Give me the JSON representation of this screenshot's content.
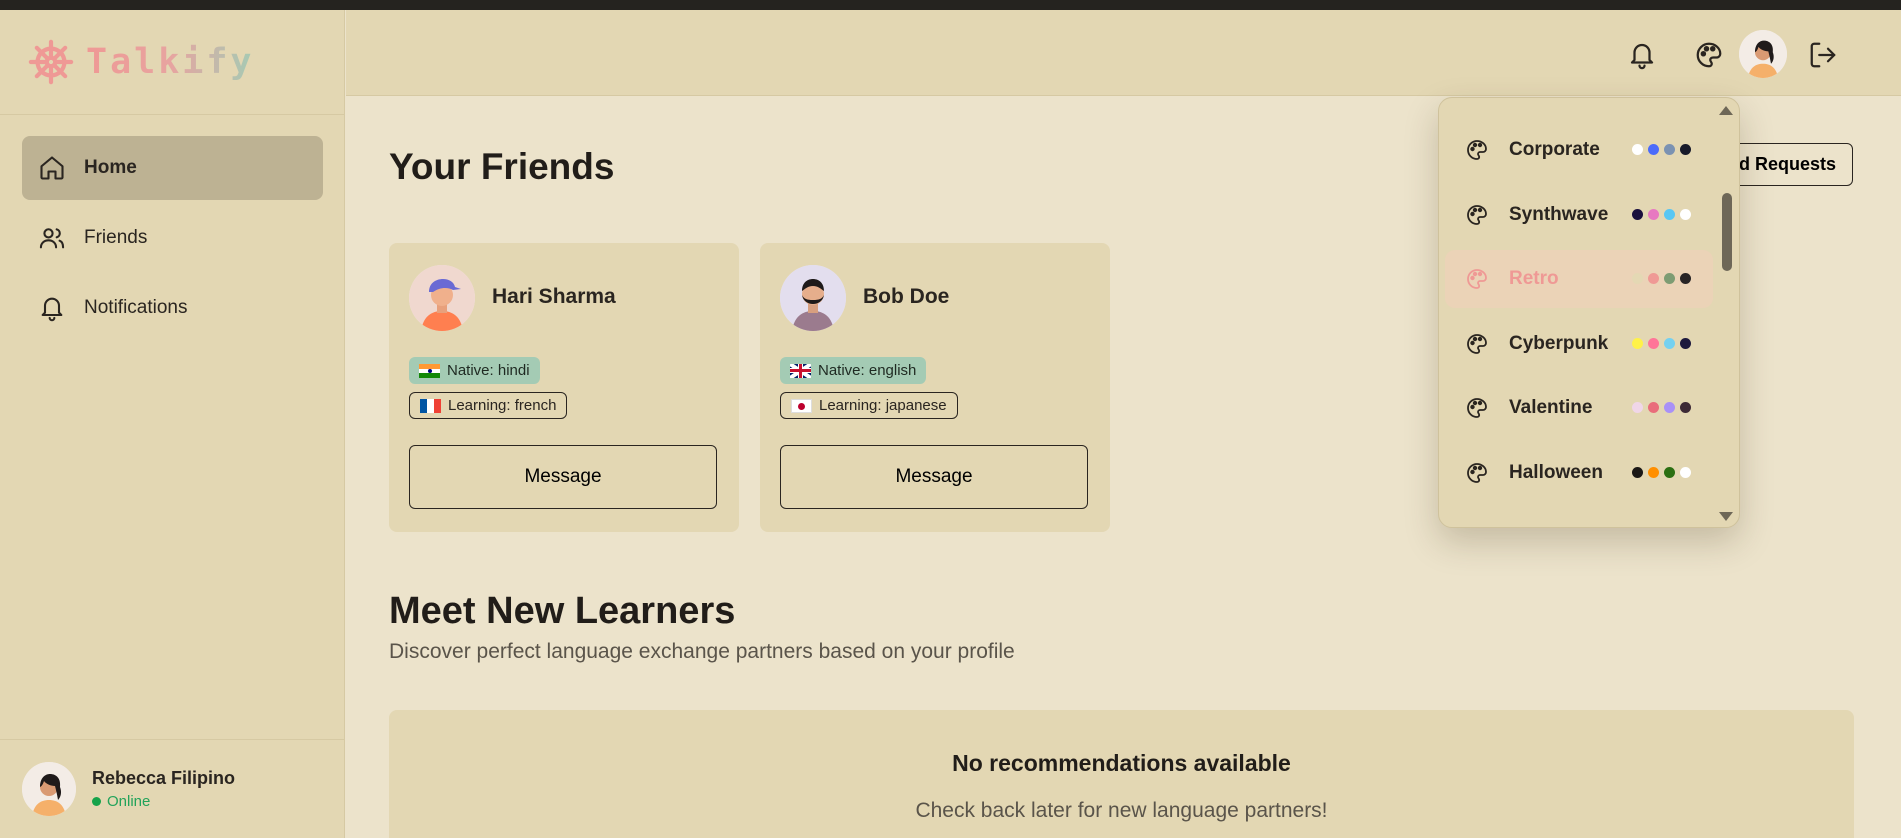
{
  "app": {
    "logo_text": "Talkify"
  },
  "sidebar": {
    "items": [
      {
        "label": "Home",
        "icon": "home-icon",
        "active": true
      },
      {
        "label": "Friends",
        "icon": "users-icon",
        "active": false
      },
      {
        "label": "Notifications",
        "icon": "bell-icon",
        "active": false
      }
    ],
    "user": {
      "name": "Rebecca Filipino",
      "status": "Online"
    }
  },
  "header": {
    "icons": [
      "bell-icon",
      "palette-icon",
      "avatar",
      "logout-icon"
    ]
  },
  "main": {
    "title": "Your Friends",
    "friend_requests_label": "Friend Requests",
    "friends": [
      {
        "name": "Hari Sharma",
        "native": "Native: hindi",
        "learning": "Learning: french",
        "message_label": "Message"
      },
      {
        "name": "Bob Doe",
        "native": "Native: english",
        "learning": "Learning: japanese",
        "message_label": "Message"
      }
    ],
    "learners_title": "Meet New Learners",
    "learners_subtitle": "Discover perfect language exchange partners based on your profile",
    "empty_title": "No recommendations available",
    "empty_subtitle": "Check back later for new language partners!"
  },
  "theme_dropdown": {
    "items": [
      {
        "label": "Corporate",
        "colors": [
          "#ffffff",
          "#4b6bfb",
          "#7b92b2",
          "#181a2a"
        ]
      },
      {
        "label": "Synthwave",
        "colors": [
          "#1a103d",
          "#e779c1",
          "#58c7f3",
          "#ffffff"
        ]
      },
      {
        "label": "Retro",
        "colors": [
          "#e4d8b4",
          "#ef9995",
          "#7d9c73",
          "#282425"
        ],
        "selected": true
      },
      {
        "label": "Cyberpunk",
        "colors": [
          "#fff248",
          "#ff7598",
          "#75d1f0",
          "#1e1a3d"
        ]
      },
      {
        "label": "Valentine",
        "colors": [
          "#f0d6e8",
          "#e96d7b",
          "#a991f7",
          "#3d2a36"
        ]
      },
      {
        "label": "Halloween",
        "colors": [
          "#1b1816",
          "#ff8f00",
          "#2b6f12",
          "#ffffff"
        ]
      }
    ]
  },
  "colors": {
    "background": "#ece3cb",
    "panel": "#e3d7b3",
    "accent": "#ef9995",
    "native_badge": "#a4cbb4",
    "online": "#16a34a"
  }
}
